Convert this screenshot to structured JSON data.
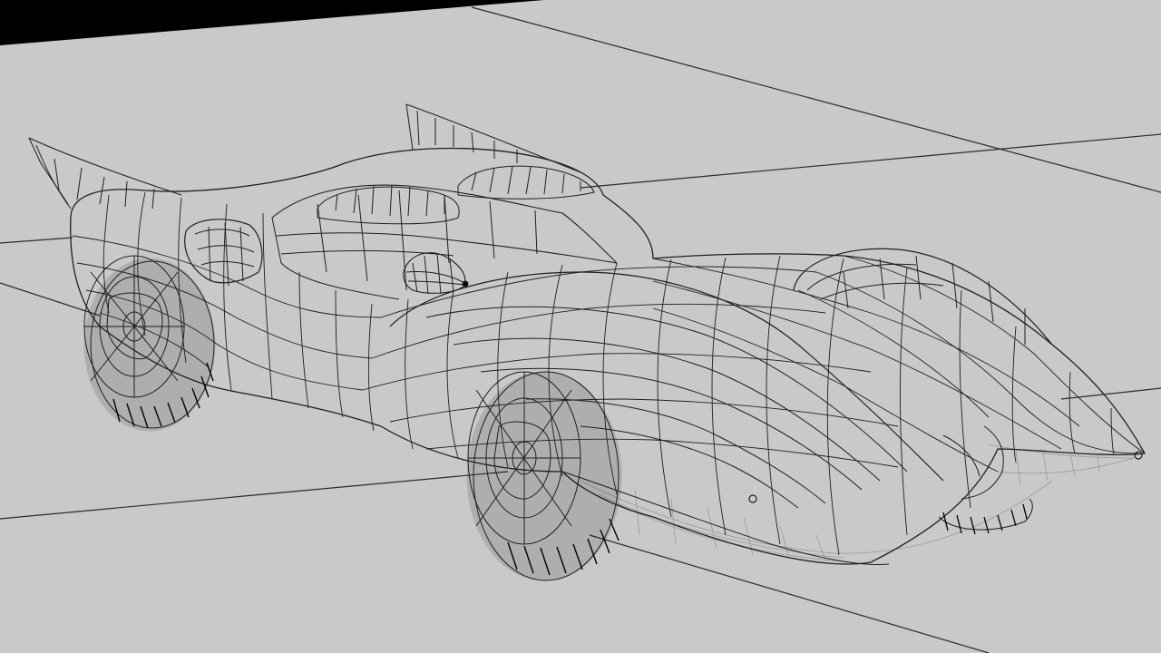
{
  "scene": {
    "background_color": "#c9c9c9",
    "ground_line_color": "#2b2b2b",
    "wire_color": "#1f1f1f",
    "ghost_wire_color": "#9a9a9a",
    "shadow_color": "#000000",
    "subject_icon": "wireframe-race-car"
  }
}
